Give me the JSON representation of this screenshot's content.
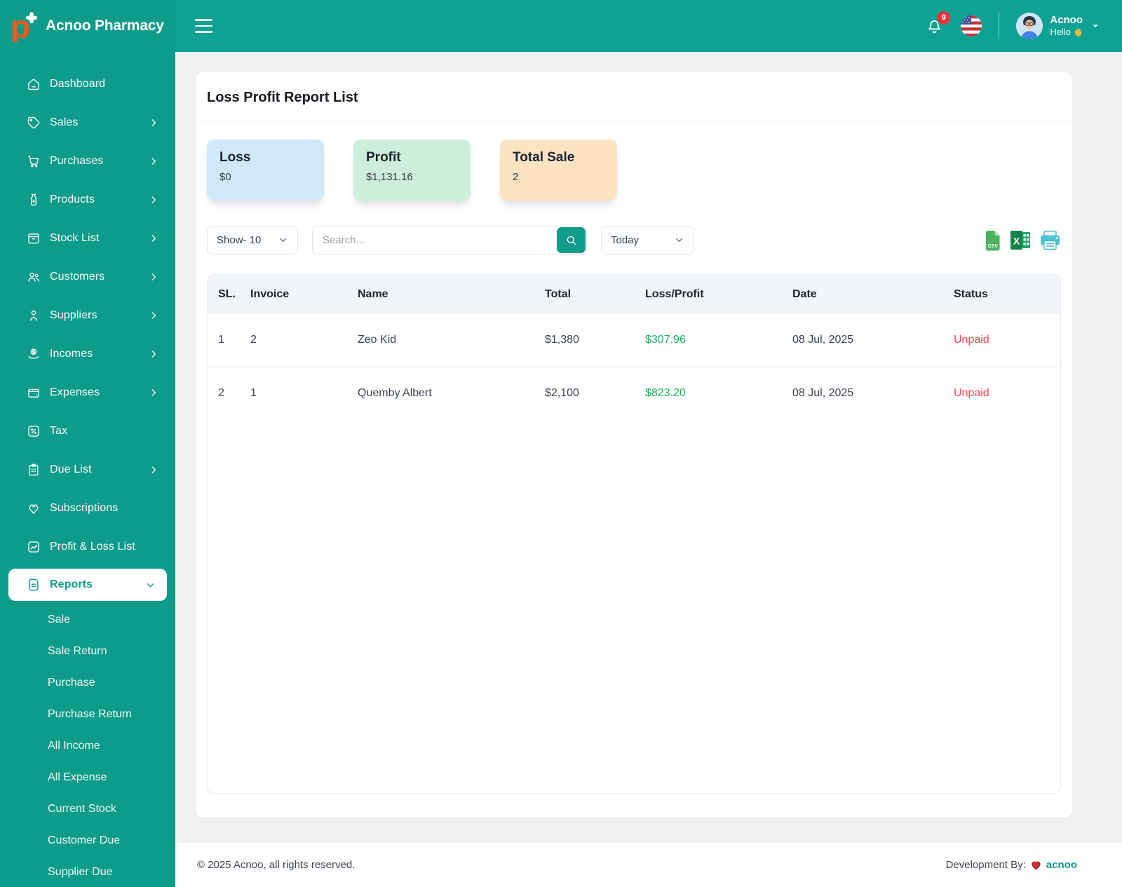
{
  "brand": {
    "name": "Acnoo Pharmacy"
  },
  "header": {
    "notification_count": "9",
    "user": {
      "name": "Acnoo",
      "greeting": "Hello",
      "wave": "👋"
    }
  },
  "sidebar": {
    "items": [
      {
        "label": "Dashboard",
        "icon": "home-icon",
        "arrow": false
      },
      {
        "label": "Sales",
        "icon": "tag-icon",
        "arrow": true
      },
      {
        "label": "Purchases",
        "icon": "cart-icon",
        "arrow": true
      },
      {
        "label": "Products",
        "icon": "medicine-bottle-icon",
        "arrow": true
      },
      {
        "label": "Stock List",
        "icon": "box-icon",
        "arrow": true
      },
      {
        "label": "Customers",
        "icon": "users-icon",
        "arrow": true
      },
      {
        "label": "Suppliers",
        "icon": "person-icon",
        "arrow": true
      },
      {
        "label": "Incomes",
        "icon": "coin-hand-icon",
        "arrow": true
      },
      {
        "label": "Expenses",
        "icon": "wallet-icon",
        "arrow": true
      },
      {
        "label": "Tax",
        "icon": "percent-icon",
        "arrow": false
      },
      {
        "label": "Due List",
        "icon": "clipboard-icon",
        "arrow": true
      },
      {
        "label": "Subscriptions",
        "icon": "gem-tag-icon",
        "arrow": false
      },
      {
        "label": "Profit & Loss List",
        "icon": "trend-chart-icon",
        "arrow": false
      },
      {
        "label": "Reports",
        "icon": "report-file-icon",
        "arrow": "down",
        "active": true
      }
    ],
    "subitems": [
      "Sale",
      "Sale Return",
      "Purchase",
      "Purchase Return",
      "All Income",
      "All Expense",
      "Current Stock",
      "Customer Due",
      "Supplier Due"
    ]
  },
  "page": {
    "title": "Loss Profit Report List",
    "cards": [
      {
        "label": "Loss",
        "value": "$0",
        "bg": "#cfe9f8"
      },
      {
        "label": "Profit",
        "value": "$1,131.16",
        "bg": "#cdeeda"
      },
      {
        "label": "Total Sale",
        "value": "2",
        "bg": "#fce4c3"
      }
    ],
    "controls": {
      "show_label": "Show- 10",
      "search_placeholder": "Search...",
      "date_label": "Today"
    },
    "export_icons": [
      "csv-file-icon",
      "excel-icon",
      "printer-icon"
    ],
    "table": {
      "headers": [
        "SL.",
        "Invoice",
        "Name",
        "Total",
        "Loss/Profit",
        "Date",
        "Status"
      ],
      "rows": [
        {
          "sl": "1",
          "invoice": "2",
          "name": "Zeo Kid",
          "total": "$1,380",
          "loss_profit": "$307.96",
          "date": "08 Jul, 2025",
          "status": "Unpaid"
        },
        {
          "sl": "2",
          "invoice": "1",
          "name": "Quemby Albert",
          "total": "$2,100",
          "loss_profit": "$823.20",
          "date": "08 Jul, 2025",
          "status": "Unpaid"
        }
      ]
    }
  },
  "footer": {
    "copyright": "© 2025 Acnoo, all rights reserved.",
    "dev_label": "Development By:",
    "dev_name": "acnoo"
  },
  "colors": {
    "sidebar_teal": "#0d9b8a",
    "header_teal": "#0ea294",
    "profit_green": "#18b25b",
    "unpaid_red": "#ee4450",
    "badge_red": "#e3353d",
    "loss_card_bg": "#cfe9f8",
    "profit_card_bg": "#cdeeda",
    "total_sale_card_bg": "#fce4c3"
  }
}
